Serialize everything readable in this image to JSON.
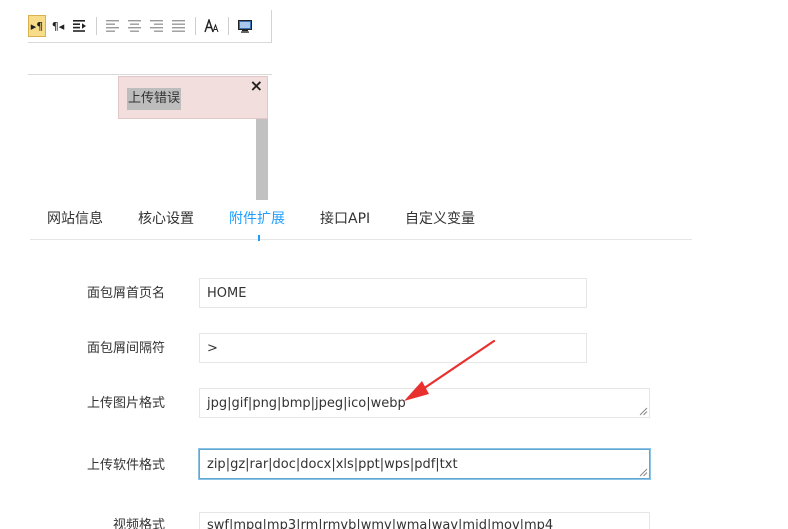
{
  "editor": {
    "toolbar": {
      "buttons": [
        {
          "icon": "paragraph-ltr-icon",
          "active": true
        },
        {
          "icon": "paragraph-rtl-icon"
        },
        {
          "icon": "indent-icon"
        },
        {
          "icon": "align-left-icon"
        },
        {
          "icon": "align-center-icon"
        },
        {
          "icon": "align-right-icon"
        },
        {
          "icon": "align-justify-icon"
        },
        {
          "icon": "font-size-icon"
        },
        {
          "icon": "preview-monitor-icon"
        }
      ]
    },
    "upload_error": {
      "message": "上传错误",
      "close_label": "×"
    }
  },
  "tabs": [
    {
      "label": "网站信息"
    },
    {
      "label": "核心设置"
    },
    {
      "label": "附件扩展",
      "active": true
    },
    {
      "label": "接口API"
    },
    {
      "label": "自定义变量"
    }
  ],
  "form": {
    "breadcrumb_home": {
      "label": "面包屑首页名",
      "value": "HOME"
    },
    "breadcrumb_separator": {
      "label": "面包屑间隔符",
      "value": ">"
    },
    "image_formats": {
      "label": "上传图片格式",
      "value": "jpg|gif|png|bmp|jpeg|ico|webp"
    },
    "software_formats": {
      "label": "上传软件格式",
      "value": "zip|gz|rar|doc|docx|xls|ppt|wps|pdf|txt"
    },
    "video_formats": {
      "label": "视频格式",
      "value": "swf|mpg|mp3|rm|rmvb|wmv|wma|wav|mid|mov|mp4"
    }
  },
  "colors": {
    "accent": "#1e9fff",
    "error_bg": "#f3dede",
    "arrow": "#e8312f"
  }
}
